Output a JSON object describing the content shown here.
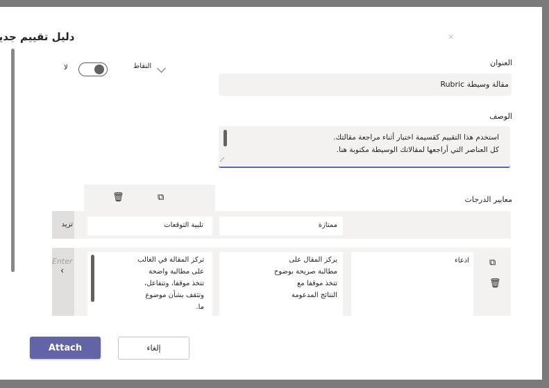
{
  "dialog": {
    "title": "دليل تقييم جديد",
    "close_icon": "close-icon"
  },
  "scoring": {
    "points_label": "النقاط",
    "toggle_label": "لا",
    "toggle_on": false
  },
  "form": {
    "title_label": "العنوان",
    "title_value": "مقالة وسيطة Rubric",
    "description_label": "الوصف",
    "description_value": "استخدم هذا التقييم كقسيمة اختبار أثناء مراجعة مقالتك. كل العناصر التي أراجعها لمقالاتك الوسيطة مكتوبة هنا."
  },
  "criteria": {
    "section_label": "معايير الدرجات",
    "levels": [
      {
        "label": "ممتازة"
      },
      {
        "label": "تلبية التوقعات"
      },
      {
        "label": "تزيد"
      }
    ],
    "rows": [
      {
        "name": "ادعاء",
        "cells": [
          "يركز المقال على\nمطالبة صريحة بوضوح\nتتخذ موقفا مع\nالنتائج المدعومة",
          "تركز المقالة في الغالب\nعلى مطالبة واضحة\nتتخذ موقفا، وتتفاعل،\nوتثقف بشأن موضوع\nما."
        ]
      }
    ],
    "placeholder_partial": "Enter"
  },
  "buttons": {
    "primary": "Attach",
    "secondary": "إلغاء"
  },
  "colors": {
    "accent": "#6264a7",
    "field_bg": "#f3f2f1",
    "overlay": "#7a7a7a"
  }
}
